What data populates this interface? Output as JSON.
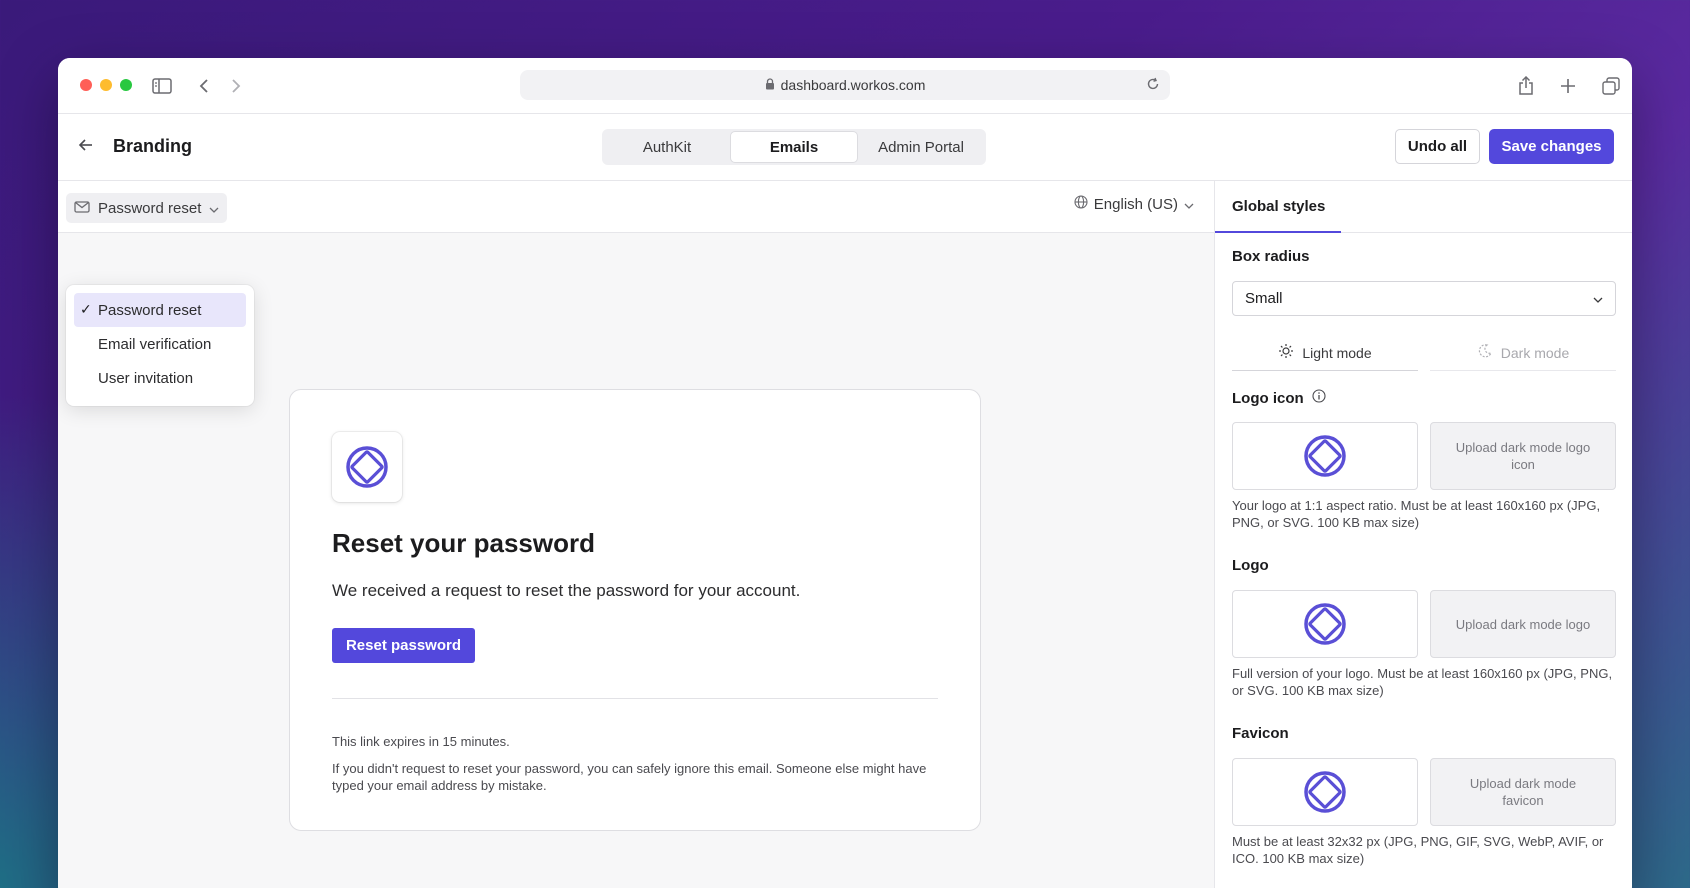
{
  "browser": {
    "url": "dashboard.workos.com"
  },
  "header": {
    "title": "Branding",
    "tabs": [
      {
        "label": "AuthKit"
      },
      {
        "label": "Emails"
      },
      {
        "label": "Admin Portal"
      }
    ],
    "undo_label": "Undo all",
    "save_label": "Save changes"
  },
  "toolbar": {
    "template_selected": "Password reset",
    "language": "English (US)"
  },
  "dropdown": {
    "items": [
      {
        "label": "Password reset",
        "selected": true
      },
      {
        "label": "Email verification"
      },
      {
        "label": "User invitation"
      }
    ]
  },
  "email": {
    "title": "Reset your password",
    "body": "We received a request to reset the password for your account.",
    "button": "Reset password",
    "note1": "This link expires in 15 minutes.",
    "note2": "If you didn't request to reset your password, you can safely ignore this email. Someone else might have typed your email address by mistake."
  },
  "sidebar": {
    "tab": "Global styles",
    "box_radius_label": "Box radius",
    "box_radius_value": "Small",
    "light_mode": "Light mode",
    "dark_mode": "Dark mode",
    "logo_icon": {
      "label": "Logo icon",
      "dark_upload": "Upload dark mode logo icon",
      "help": "Your logo at 1:1 aspect ratio. Must be at least 160x160 px (JPG, PNG, or SVG. 100 KB max size)"
    },
    "logo": {
      "label": "Logo",
      "dark_upload": "Upload dark mode logo",
      "help": "Full version of your logo. Must be at least 160x160 px (JPG, PNG, or SVG. 100 KB max size)"
    },
    "favicon": {
      "label": "Favicon",
      "dark_upload": "Upload dark mode favicon",
      "help": "Must be at least 32x32 px (JPG, PNG, GIF, SVG, WebP, AVIF, or ICO. 100 KB max size)"
    }
  },
  "colors": {
    "accent": "#5348dc",
    "logo": "#5a4fd6"
  }
}
